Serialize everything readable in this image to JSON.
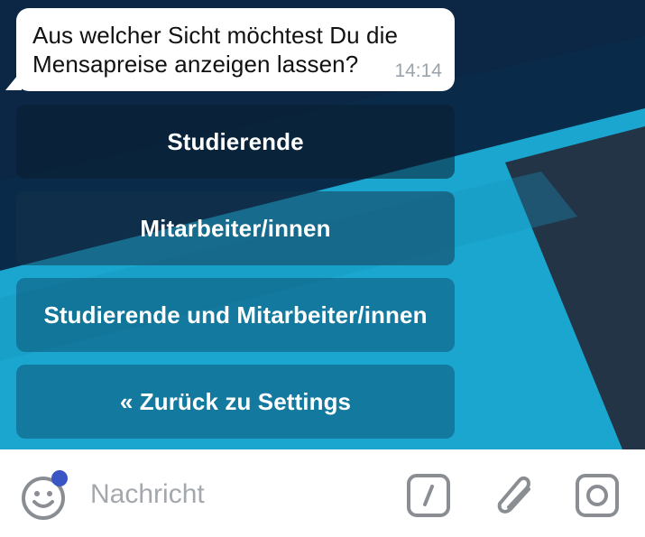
{
  "message": {
    "text": "Aus welcher Sicht möchtest Du die Mensapreise anzeigen lassen?",
    "time": "14:14"
  },
  "keyboard": {
    "buttons": [
      {
        "label": "Studierende"
      },
      {
        "label": "Mitarbeiter/innen"
      },
      {
        "label": "Studierende und Mitarbeiter/innen"
      },
      {
        "label": "« Zurück zu Settings"
      }
    ]
  },
  "composer": {
    "placeholder": "Nachricht",
    "value": "",
    "icons": {
      "emoji": "smiley-icon",
      "commands": "slash-command-icon",
      "attach": "paperclip-icon",
      "camera": "camera-icon"
    },
    "emoji_badge_color": "#3a55c4"
  }
}
